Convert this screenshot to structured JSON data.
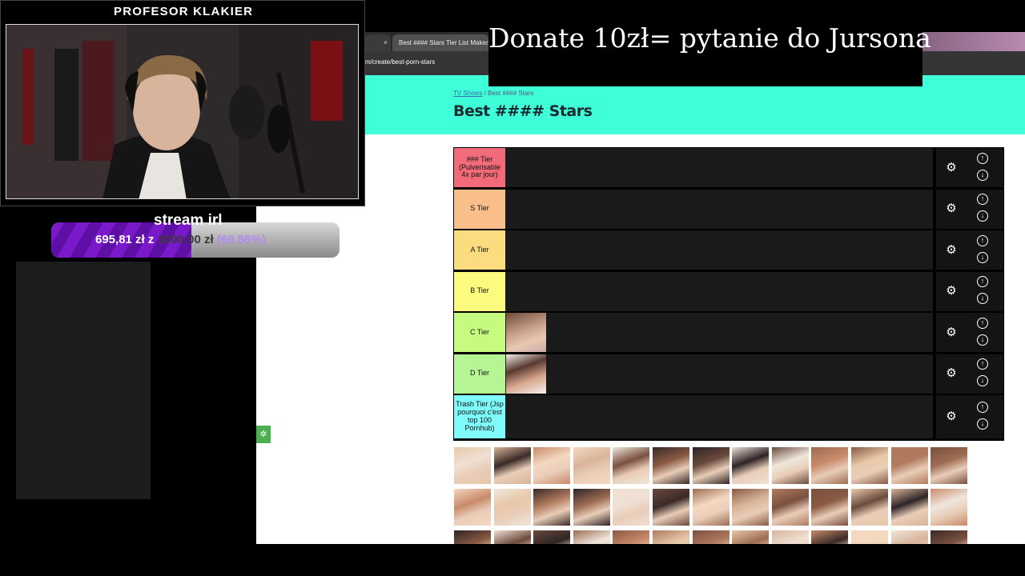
{
  "browser": {
    "tabs": [
      {
        "label": "",
        "close_glyph": "×"
      },
      {
        "label": "Best #### Stars Tier List Maker"
      }
    ],
    "url_prefix": "",
    "url_path": "m/create/best-porn-stars",
    "breadcrumb": {
      "parent": "TV Shows",
      "separator": " / ",
      "current": "Best #### Stars"
    },
    "page_title": "Best #### Stars"
  },
  "tiers": [
    {
      "label": "### Tier (Pulverisable 4x par jour)",
      "color": "#f26b7a",
      "items": 0
    },
    {
      "label": "S Tier",
      "color": "#f9bf8b",
      "items": 0
    },
    {
      "label": "A Tier",
      "color": "#fbdd80",
      "items": 0
    },
    {
      "label": "B Tier",
      "color": "#fbfb80",
      "items": 0
    },
    {
      "label": "C Tier",
      "color": "#c7fb80",
      "items": 1
    },
    {
      "label": "D Tier",
      "color": "#b5f594",
      "items": 1
    },
    {
      "label": "Trash Tier (Jsp pourquoi c'est top 100 Pornhub)",
      "color": "#80fbfb",
      "items": 0
    }
  ],
  "tier_controls": {
    "settings_icon": "gear-icon",
    "up_icon": "arrow-up-circle-icon",
    "down_icon": "arrow-down-circle-icon"
  },
  "overlay": {
    "donate_text": "Donate 10zł= pytanie do Jursona",
    "cam_title": "PROFESOR KLAKIER",
    "goal": {
      "title": "stream irl",
      "current": "695,81 zł",
      "connector": "z",
      "total": "1000,00 zł",
      "percent_text": "(69.58%)",
      "progress": 0.6958
    }
  },
  "colors": {
    "header_accent": "#3fffd8",
    "goal_purple": "#7a19c9"
  }
}
